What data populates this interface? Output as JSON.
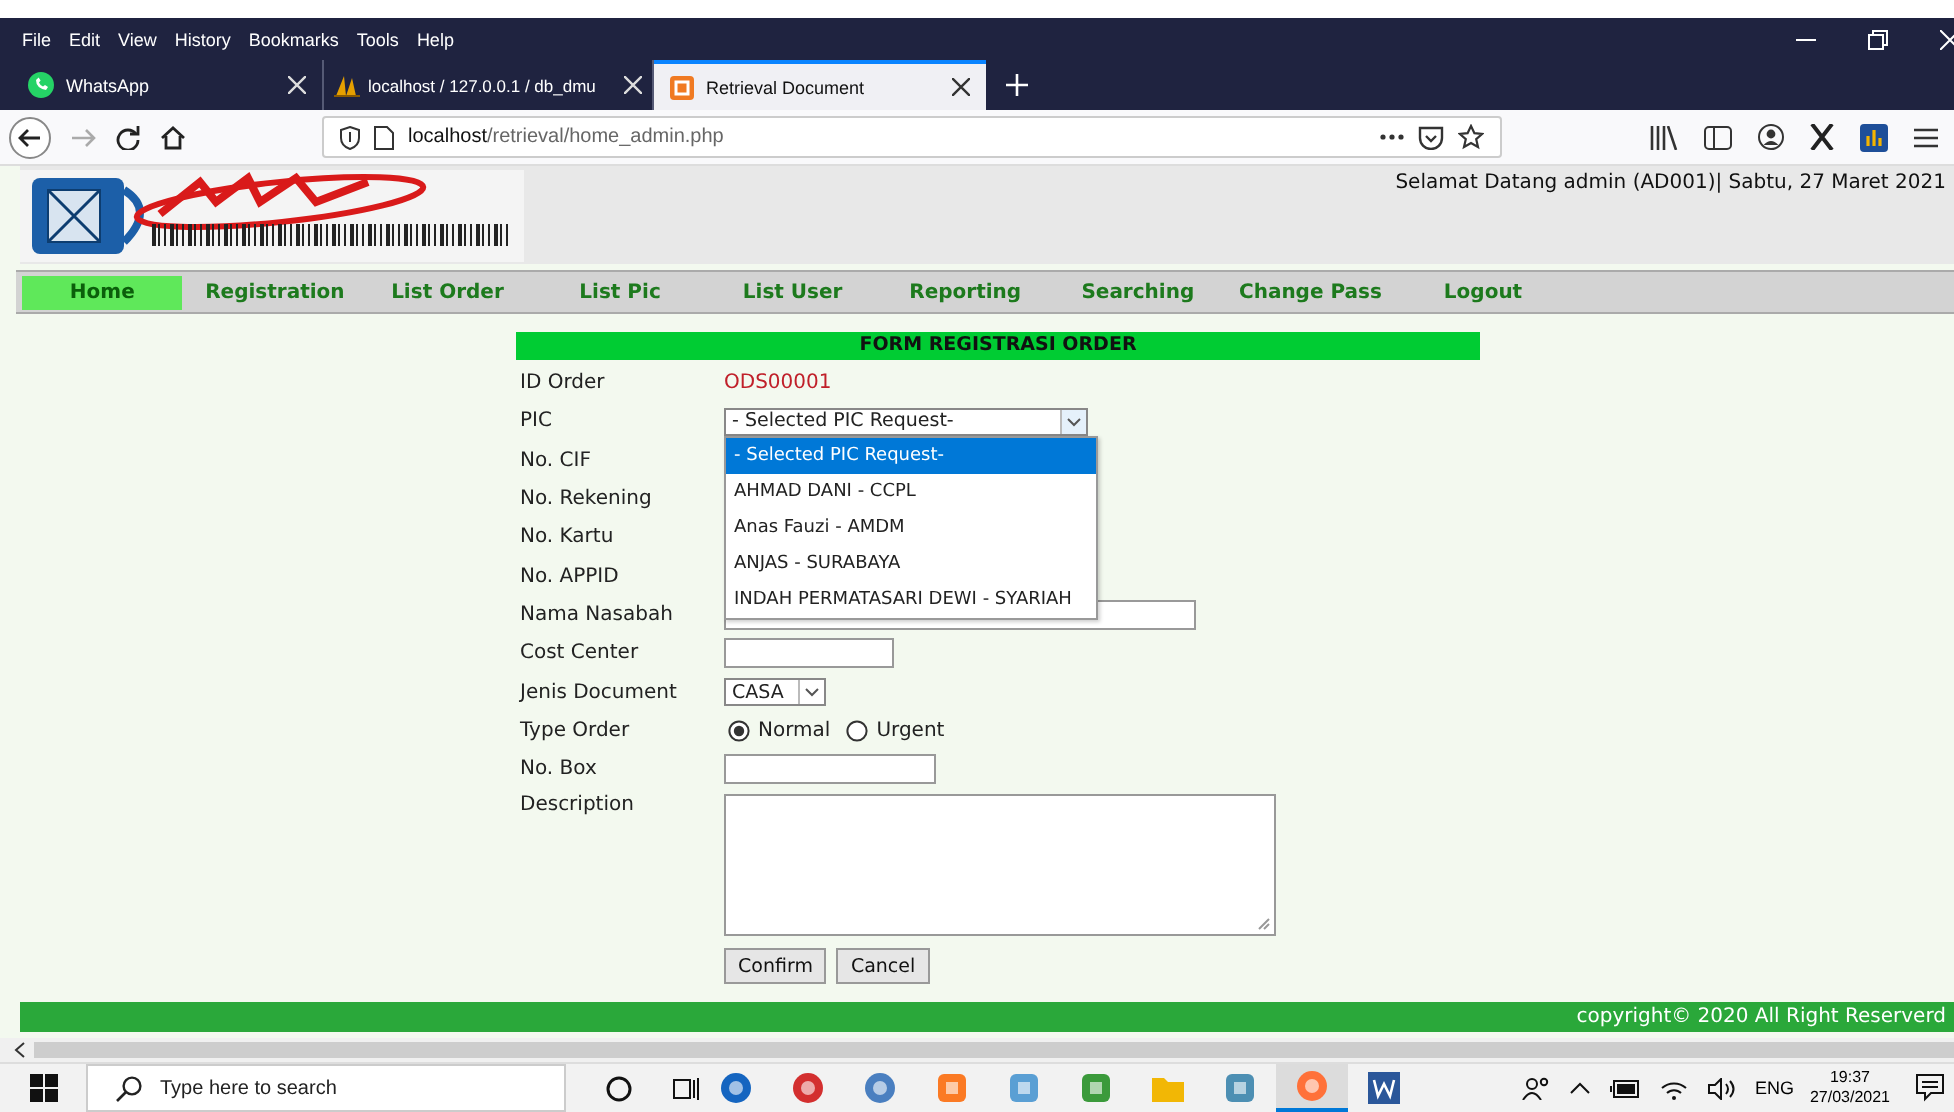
{
  "browser": {
    "menu": [
      "File",
      "Edit",
      "View",
      "History",
      "Bookmarks",
      "Tools",
      "Help"
    ],
    "tabs": [
      {
        "title": "WhatsApp",
        "kind": "chat",
        "selected": false
      },
      {
        "title": "localhost / 127.0.0.1 / db_dmu",
        "kind": "database",
        "selected": false
      },
      {
        "title": "Retrieval Document",
        "kind": "app",
        "selected": true
      }
    ],
    "url": {
      "host": "localhost",
      "path": "/retrieval/home_admin.php"
    }
  },
  "page": {
    "welcome": "Selamat Datang admin (AD001)| Sabtu, 27 Maret 2021",
    "nav": [
      {
        "label": "Home",
        "selected": true
      },
      {
        "label": "Registration",
        "selected": false
      },
      {
        "label": "List Order",
        "selected": false
      },
      {
        "label": "List Pic",
        "selected": false
      },
      {
        "label": "List User",
        "selected": false
      },
      {
        "label": "Reporting",
        "selected": false
      },
      {
        "label": "Searching",
        "selected": false
      },
      {
        "label": "Change Pass",
        "selected": false
      },
      {
        "label": "Logout",
        "selected": false
      }
    ],
    "form": {
      "title": "FORM REGISTRASI ORDER",
      "fields": [
        {
          "label": "ID Order",
          "kind": "value",
          "value": "ODS00001"
        },
        {
          "label": "PIC",
          "kind": "select",
          "value": "- Selected PIC Request-",
          "expanded": true,
          "options": [
            {
              "label": "- Selected PIC Request-",
              "selected": true
            },
            {
              "label": "AHMAD DANI - CCPL",
              "selected": false
            },
            {
              "label": "Anas Fauzi - AMDM",
              "selected": false
            },
            {
              "label": "ANJAS - SURABAYA",
              "selected": false
            },
            {
              "label": "INDAH PERMATASARI DEWI - SYARIAH",
              "selected": false
            }
          ]
        },
        {
          "label": "No. CIF",
          "kind": "covered"
        },
        {
          "label": "No. Rekening",
          "kind": "covered"
        },
        {
          "label": "No. Kartu",
          "kind": "covered"
        },
        {
          "label": "No. APPID",
          "kind": "covered"
        },
        {
          "label": "Nama Nasabah",
          "kind": "input"
        },
        {
          "label": "Cost Center",
          "kind": "input"
        },
        {
          "label": "Jenis Document",
          "kind": "select",
          "value": "CASA",
          "expanded": false
        },
        {
          "label": "Type Order",
          "kind": "radio",
          "options": [
            {
              "label": "Normal",
              "selected": true
            },
            {
              "label": "Urgent",
              "selected": false
            }
          ]
        },
        {
          "label": "No. Box",
          "kind": "input"
        },
        {
          "label": "Description",
          "kind": "textarea"
        }
      ],
      "buttons": [
        "Confirm",
        "Cancel"
      ]
    },
    "footer": "copyright© 2020 All Right Reserverd"
  },
  "taskbar": {
    "search_placeholder": "Type here to search",
    "apps": [
      {
        "kind": "browser-round",
        "selected": false
      },
      {
        "kind": "flash",
        "selected": false
      },
      {
        "kind": "media",
        "selected": false
      },
      {
        "kind": "xampp",
        "selected": false
      },
      {
        "kind": "paint",
        "selected": false
      },
      {
        "kind": "notepad",
        "selected": false
      },
      {
        "kind": "folder",
        "selected": false
      },
      {
        "kind": "book",
        "selected": false
      },
      {
        "kind": "firefox",
        "selected": true
      },
      {
        "kind": "word",
        "selected": false
      }
    ],
    "language": "ENG",
    "time": "19:37",
    "date": "27/03/2021"
  }
}
